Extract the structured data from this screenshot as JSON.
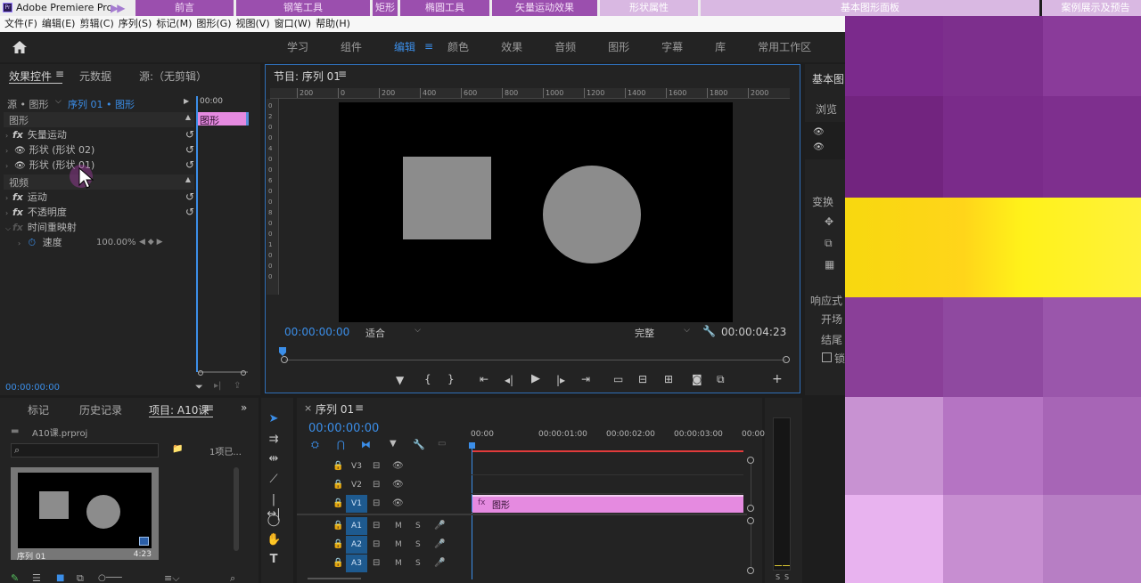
{
  "app": {
    "title": "Adobe Premiere Pro",
    "logo_text": "Pr"
  },
  "chapter_tabs": [
    {
      "label": "前言",
      "w": 110,
      "dim": false
    },
    {
      "label": "钢笔工具",
      "w": 150,
      "dim": false
    },
    {
      "label": "矩形",
      "w": 28,
      "dim": false
    },
    {
      "label": "椭圆工具",
      "w": 100,
      "dim": false
    },
    {
      "label": "矢量运动效果",
      "w": 118,
      "dim": false
    },
    {
      "label": "形状属性",
      "w": 110,
      "dim": true
    },
    {
      "label": "基本图形面板",
      "w": 380,
      "dim": true
    },
    {
      "label": "案例展示及预告",
      "w": 120,
      "dim": true
    }
  ],
  "menu": [
    "文件(F)",
    "编辑(E)",
    "剪辑(C)",
    "序列(S)",
    "标记(M)",
    "图形(G)",
    "视图(V)",
    "窗口(W)",
    "帮助(H)"
  ],
  "workspaces": [
    "学习",
    "组件",
    "编辑",
    "颜色",
    "效果",
    "音频",
    "图形",
    "字幕",
    "库",
    "常用工作区"
  ],
  "workspace_active": "编辑",
  "effect_controls": {
    "tabs": [
      "效果控件",
      "元数据",
      "源:（无剪辑）"
    ],
    "source_label": "源 • 图形",
    "sequence_label": "序列 01 • 图形",
    "ruler_time": "00:00",
    "clip_label": "图形",
    "section_graphics": "图形",
    "items_graphics": [
      {
        "type": "fx",
        "label": "矢量运动"
      },
      {
        "type": "eye",
        "label": "形状 (形状 02)"
      },
      {
        "type": "eye",
        "label": "形状 (形状 01)"
      }
    ],
    "section_video": "视频",
    "items_video": [
      {
        "type": "fx",
        "label": "运动"
      },
      {
        "type": "fx",
        "label": "不透明度"
      },
      {
        "type": "fxdim",
        "label": "时间重映射"
      }
    ],
    "speed_label": "速度",
    "speed_value": "100.00%",
    "timecode": "00:00:00:00"
  },
  "program": {
    "title": "节目: 序列 01",
    "ruler_ticks": [
      "200",
      "0",
      "200",
      "400",
      "600",
      "800",
      "1000",
      "1200",
      "1400",
      "1600",
      "1800",
      "2000"
    ],
    "vruler_ticks": [
      "0",
      "2",
      "0",
      "0",
      "4",
      "0",
      "0",
      "6",
      "0",
      "0",
      "8",
      "0",
      "0",
      "1",
      "0",
      "0",
      "0"
    ],
    "timecode": "00:00:00:00",
    "fit": "适合",
    "quality": "完整",
    "duration": "00:00:04:23"
  },
  "right_panel": {
    "title": "基本图",
    "browse": "浏览",
    "transform": "变换",
    "responsive": "响应式",
    "start": "开场",
    "end": "结尾",
    "check": "锁"
  },
  "project": {
    "tabs": [
      "标记",
      "历史记录",
      "项目: A10课"
    ],
    "file": "A10课.prproj",
    "count": "1项已...",
    "thumb_name": "序列 01",
    "thumb_dur": "4:23"
  },
  "timeline": {
    "title": "序列 01",
    "timecode": "00:00:00:00",
    "ruler": [
      "00:00",
      "00:00:01:00",
      "00:00:02:00",
      "00:00:03:00",
      "00:00"
    ],
    "video_tracks": [
      "V3",
      "V2",
      "V1"
    ],
    "audio_tracks": [
      "A1",
      "A2",
      "A3"
    ],
    "clip_label": "图形"
  },
  "meter": {
    "labels": [
      "S",
      "S"
    ]
  },
  "colors": {
    "accent": "#3b8ee8",
    "clip_pink": "#e58ae0",
    "chapter": "#9b4fae",
    "yellow": "#ffe81a"
  }
}
